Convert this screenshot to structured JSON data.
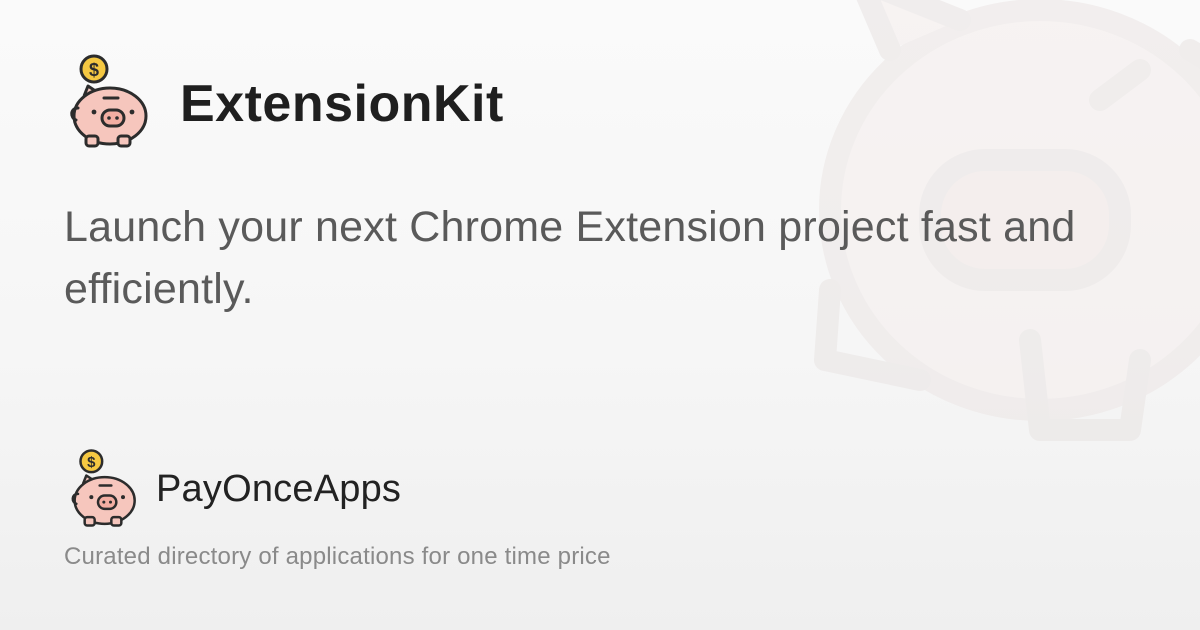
{
  "app": {
    "title": "ExtensionKit",
    "tagline": "Launch your next Chrome Extension project fast and efficiently."
  },
  "brand": {
    "name": "PayOnceApps",
    "description": "Curated directory of applications for one time price",
    "logo_icon": "piggy-bank-coin-icon"
  },
  "colors": {
    "pig_body": "#f6c6bd",
    "pig_outline": "#2c2c2c",
    "coin": "#f5c842",
    "title_text": "#1f1f1f",
    "tagline_text": "#5a5a5a",
    "desc_text": "#8a8a8a"
  }
}
